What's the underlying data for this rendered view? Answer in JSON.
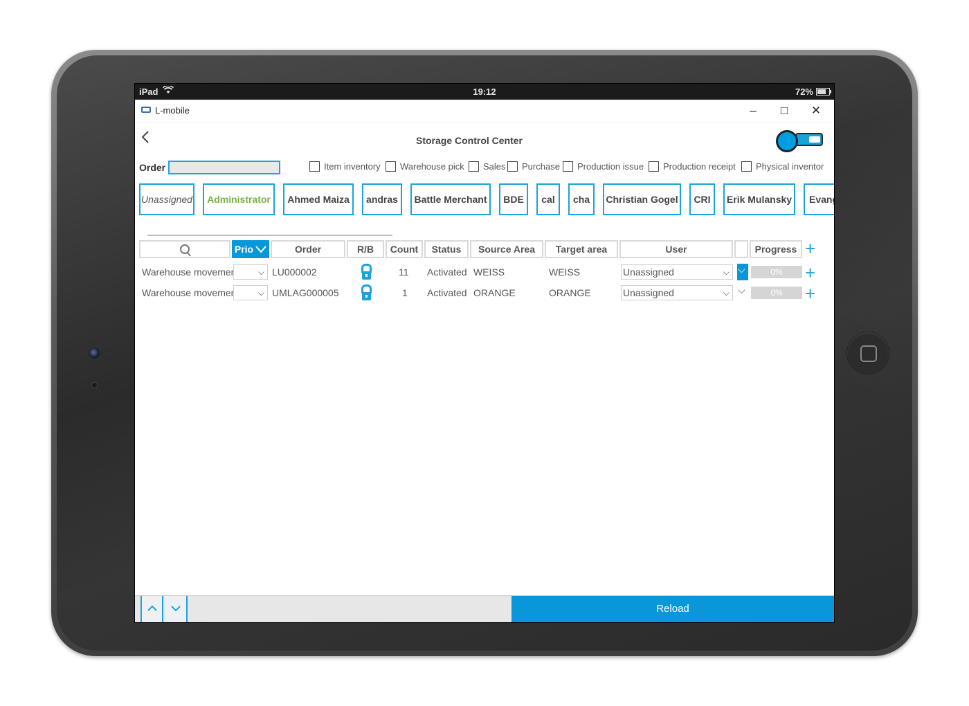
{
  "device": {
    "name": "iPad"
  },
  "status_bar": {
    "carrier": "iPad",
    "time": "19:12",
    "battery": "72%"
  },
  "window": {
    "app_name": "L-mobile",
    "minimize_glyph": "–",
    "maximize_glyph": "□",
    "close_glyph": "✕"
  },
  "header": {
    "title": "Storage Control Center",
    "back_icon": "chevron-left-icon"
  },
  "filters": {
    "order_label": "Order",
    "order_value": "",
    "checkboxes": [
      {
        "label": "Item inventory",
        "checked": false
      },
      {
        "label": "Warehouse pick",
        "checked": false
      },
      {
        "label": "Sales",
        "checked": false
      },
      {
        "label": "Purchase",
        "checked": false
      },
      {
        "label": "Production issue",
        "checked": false
      },
      {
        "label": "Production receipt",
        "checked": false
      },
      {
        "label": "Physical inventor",
        "checked": false
      }
    ]
  },
  "users": [
    {
      "label": "Unassigned"
    },
    {
      "label": "Administrator"
    },
    {
      "label": "Ahmed Maiza"
    },
    {
      "label": "andras"
    },
    {
      "label": "Battle Merchant"
    },
    {
      "label": "BDE"
    },
    {
      "label": "cal"
    },
    {
      "label": "cha"
    },
    {
      "label": "Christian Gogel"
    },
    {
      "label": "CRI"
    },
    {
      "label": "Erik Mulansky"
    },
    {
      "label": "Evang"
    }
  ],
  "table": {
    "headers": {
      "prio": "Prio",
      "order": "Order",
      "rb": "R/B",
      "count": "Count",
      "status": "Status",
      "source": "Source Area",
      "target": "Target area",
      "user": "User",
      "progress": "Progress"
    },
    "rows": [
      {
        "type": "Warehouse movement",
        "prio": "",
        "order": "LU000002",
        "count": "11",
        "status": "Activated",
        "source": "WEISS",
        "target": "WEISS",
        "user": "Unassigned",
        "progress": "0%",
        "progress_value": 0
      },
      {
        "type": "Warehouse movement",
        "prio": "",
        "order": "UMLAG000005",
        "count": "1",
        "status": "Activated",
        "source": "ORANGE",
        "target": "ORANGE",
        "user": "Unassigned",
        "progress": "0%",
        "progress_value": 0
      }
    ]
  },
  "footer": {
    "reload_label": "Reload"
  },
  "colors": {
    "accent": "#0a97d9",
    "active_user": "#7ab340",
    "chip_border": "#1aa3db"
  }
}
